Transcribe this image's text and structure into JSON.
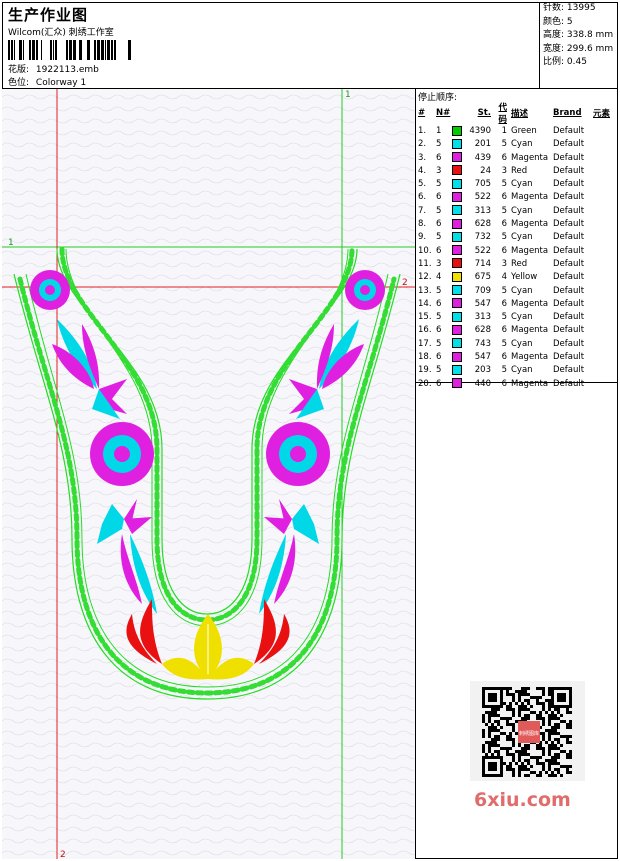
{
  "header": {
    "title": "生产作业图",
    "subtitle": "Wilcom(汇众) 刺绣工作室",
    "design_label": "花版:",
    "design_file": "1922113.emb",
    "color_label": "色位:",
    "colorway": "Colorway 1"
  },
  "stats": [
    {
      "label": "针数:",
      "value": "13995"
    },
    {
      "label": "颜色:",
      "value": "5"
    },
    {
      "label": "高度:",
      "value": "338.8 mm"
    },
    {
      "label": "宽度:",
      "value": "299.6 mm"
    },
    {
      "label": "比例:",
      "value": "0.45"
    }
  ],
  "stop_sequence": {
    "title": "停止顺序:",
    "columns": [
      "#",
      "N#",
      "St.",
      "代码",
      "描述",
      "Brand",
      "元素"
    ],
    "rows": [
      {
        "idx": "1.",
        "n": "1",
        "color": "#00cc00",
        "st": "4390",
        "code": "1",
        "desc": "Green",
        "brand": "Default"
      },
      {
        "idx": "2.",
        "n": "5",
        "color": "#00e0e8",
        "st": "201",
        "code": "5",
        "desc": "Cyan",
        "brand": "Default"
      },
      {
        "idx": "3.",
        "n": "6",
        "color": "#e020e0",
        "st": "439",
        "code": "6",
        "desc": "Magenta",
        "brand": "Default"
      },
      {
        "idx": "4.",
        "n": "3",
        "color": "#e81010",
        "st": "24",
        "code": "3",
        "desc": "Red",
        "brand": "Default"
      },
      {
        "idx": "5.",
        "n": "5",
        "color": "#00e0e8",
        "st": "705",
        "code": "5",
        "desc": "Cyan",
        "brand": "Default"
      },
      {
        "idx": "6.",
        "n": "6",
        "color": "#e020e0",
        "st": "522",
        "code": "6",
        "desc": "Magenta",
        "brand": "Default"
      },
      {
        "idx": "7.",
        "n": "5",
        "color": "#00e0e8",
        "st": "313",
        "code": "5",
        "desc": "Cyan",
        "brand": "Default"
      },
      {
        "idx": "8.",
        "n": "6",
        "color": "#e020e0",
        "st": "628",
        "code": "6",
        "desc": "Magenta",
        "brand": "Default"
      },
      {
        "idx": "9.",
        "n": "5",
        "color": "#00e0e8",
        "st": "732",
        "code": "5",
        "desc": "Cyan",
        "brand": "Default"
      },
      {
        "idx": "10.",
        "n": "6",
        "color": "#e020e0",
        "st": "522",
        "code": "6",
        "desc": "Magenta",
        "brand": "Default"
      },
      {
        "idx": "11.",
        "n": "3",
        "color": "#e81010",
        "st": "714",
        "code": "3",
        "desc": "Red",
        "brand": "Default"
      },
      {
        "idx": "12.",
        "n": "4",
        "color": "#f0e000",
        "st": "675",
        "code": "4",
        "desc": "Yellow",
        "brand": "Default"
      },
      {
        "idx": "13.",
        "n": "5",
        "color": "#00e0e8",
        "st": "709",
        "code": "5",
        "desc": "Cyan",
        "brand": "Default"
      },
      {
        "idx": "14.",
        "n": "6",
        "color": "#e020e0",
        "st": "547",
        "code": "6",
        "desc": "Magenta",
        "brand": "Default"
      },
      {
        "idx": "15.",
        "n": "5",
        "color": "#00e0e8",
        "st": "313",
        "code": "5",
        "desc": "Cyan",
        "brand": "Default"
      },
      {
        "idx": "16.",
        "n": "6",
        "color": "#e020e0",
        "st": "628",
        "code": "6",
        "desc": "Magenta",
        "brand": "Default"
      },
      {
        "idx": "17.",
        "n": "5",
        "color": "#00e0e8",
        "st": "743",
        "code": "5",
        "desc": "Cyan",
        "brand": "Default"
      },
      {
        "idx": "18.",
        "n": "6",
        "color": "#e020e0",
        "st": "547",
        "code": "6",
        "desc": "Magenta",
        "brand": "Default"
      },
      {
        "idx": "19.",
        "n": "5",
        "color": "#00e0e8",
        "st": "203",
        "code": "5",
        "desc": "Cyan",
        "brand": "Default"
      },
      {
        "idx": "20.",
        "n": "6",
        "color": "#e020e0",
        "st": "440",
        "code": "6",
        "desc": "Magenta",
        "brand": "Default"
      }
    ]
  },
  "canvas": {
    "guide_labels": {
      "top_green": "1",
      "left_green": "1",
      "right_red": "2",
      "bottom_red": "2"
    }
  },
  "watermark": {
    "text": "6xiu.com",
    "qr_badge": "刺绣图库"
  }
}
